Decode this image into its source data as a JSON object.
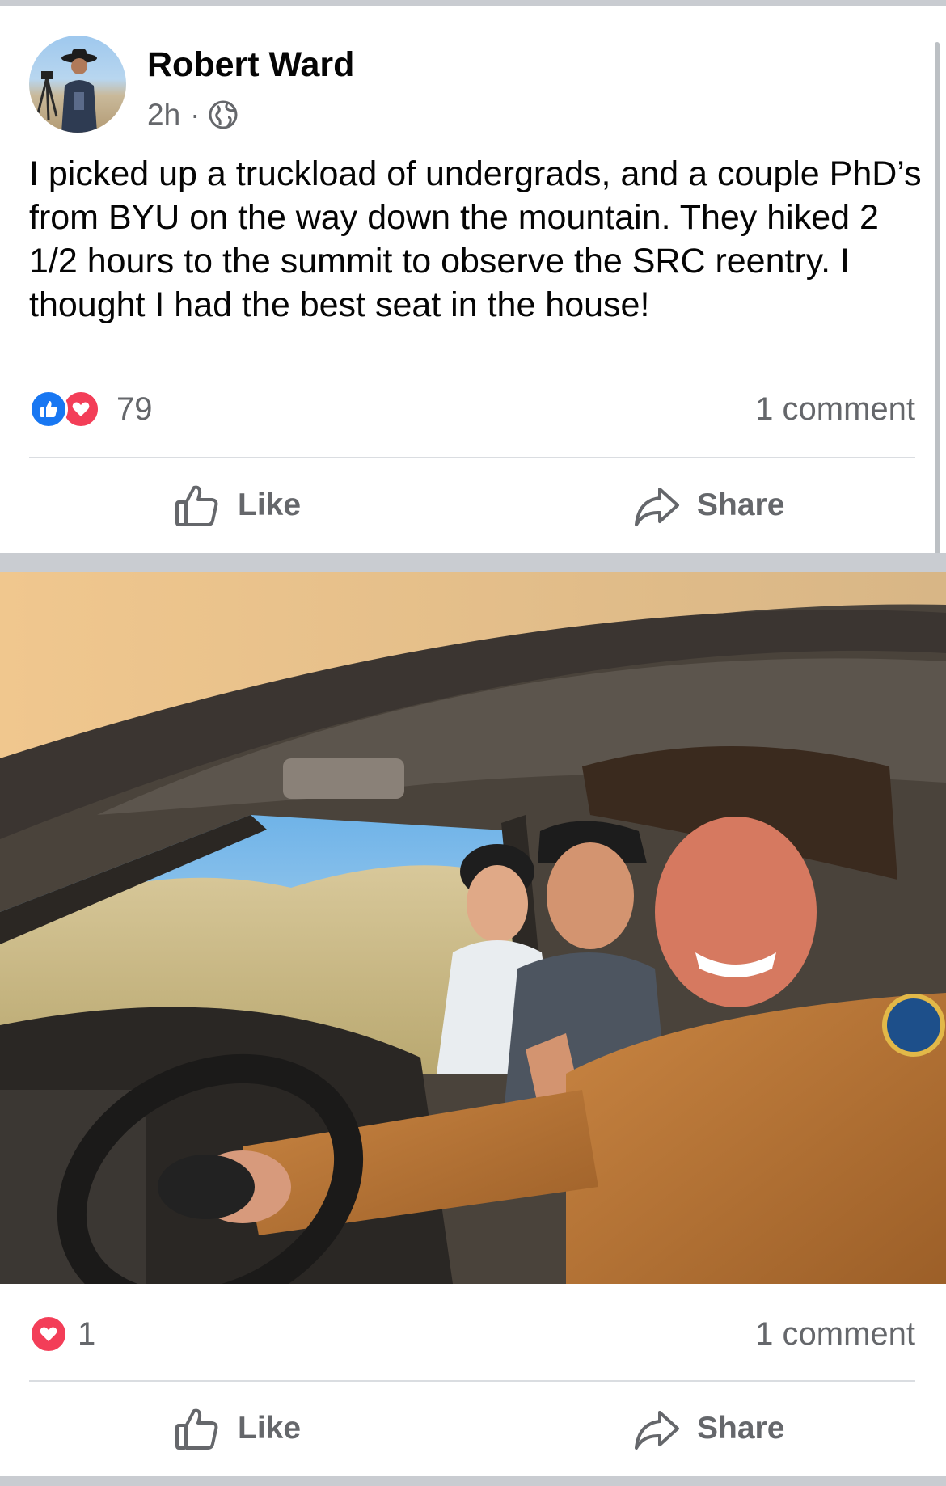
{
  "post": {
    "author": "Robert Ward",
    "time": "2h",
    "separator": "·",
    "audience_icon": "globe-icon",
    "text": "I picked up a truckload of undergrads, and a couple PhD’s from BYU on the way down the mountain. They hiked 2 1/2 hours to the summit to observe the SRC reentry. I thought I had the best seat in the house!",
    "reaction_icons": [
      "like-icon",
      "love-icon"
    ],
    "reaction_count": "79",
    "comment_count": "1 comment",
    "actions": {
      "like": "Like",
      "share": "Share"
    }
  },
  "photo_post": {
    "reaction_icons": [
      "love-icon"
    ],
    "reaction_count": "1",
    "comment_count": "1 comment",
    "actions": {
      "like": "Like",
      "share": "Share"
    }
  },
  "colors": {
    "text_primary": "#050505",
    "text_secondary": "#65676b",
    "like_blue": "#1877f2",
    "love_red": "#f33e58",
    "divider": "#dadde1",
    "section_gap": "#c9ccd1"
  }
}
